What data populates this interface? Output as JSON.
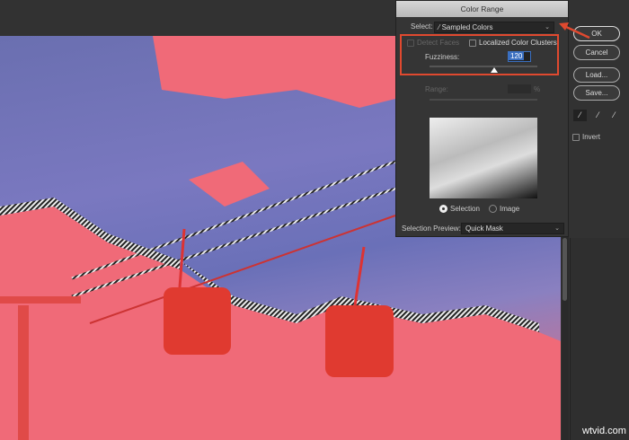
{
  "dialog": {
    "title": "Color Range",
    "select_label": "Select:",
    "select_value": "Sampled Colors",
    "detect_faces": "Detect Faces",
    "localized": "Localized Color Clusters",
    "fuzziness_label": "Fuzziness:",
    "fuzziness_value": "120",
    "fuzziness_fraction": 0.6,
    "range_label": "Range:",
    "range_unit": "%",
    "radio_selection": "Selection",
    "radio_image": "Image",
    "preview_label": "Selection Preview:",
    "preview_value": "Quick Mask"
  },
  "buttons": {
    "ok": "OK",
    "cancel": "Cancel",
    "load": "Load...",
    "save": "Save..."
  },
  "invert": "Invert",
  "watermark": "wtvid.com",
  "colors": {
    "highlight": "#e0492f",
    "mask": "#f06a78",
    "sky": "#6a70b8"
  }
}
